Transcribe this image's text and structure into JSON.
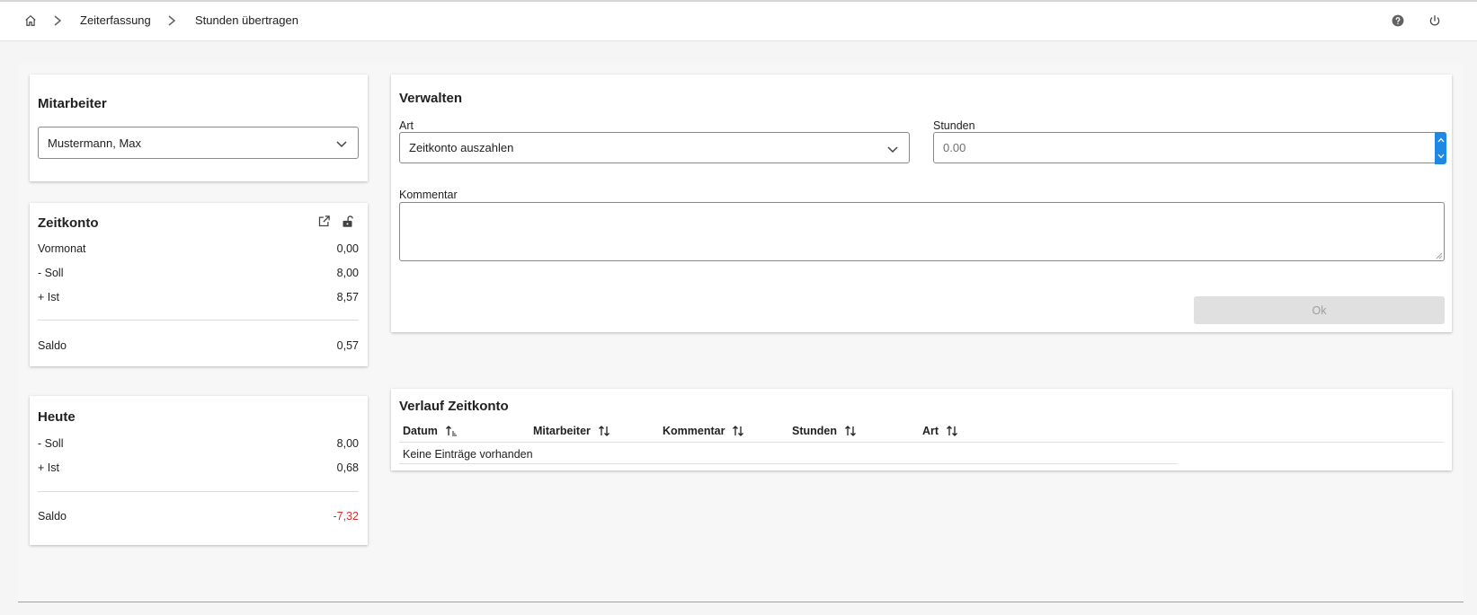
{
  "breadcrumb": {
    "home_icon": "home-icon",
    "items": [
      "Zeiterfassung",
      "Stunden übertragen"
    ]
  },
  "header_icons": [
    "help-icon",
    "power-icon"
  ],
  "mitarbeiter": {
    "title": "Mitarbeiter",
    "selected": "Mustermann, Max"
  },
  "zeitkonto": {
    "title": "Zeitkonto",
    "rows": [
      {
        "label": "Vormonat",
        "value": "0,00"
      },
      {
        "label": "- Soll",
        "value": "8,00"
      },
      {
        "label": "+ Ist",
        "value": "8,57"
      }
    ],
    "saldo": {
      "label": "Saldo",
      "value": "0,57"
    }
  },
  "heute": {
    "title": "Heute",
    "rows": [
      {
        "label": "- Soll",
        "value": "8,00"
      },
      {
        "label": "+ Ist",
        "value": "0,68"
      }
    ],
    "saldo": {
      "label": "Saldo",
      "value": "-7,32",
      "color": "#d32f2f"
    }
  },
  "verwalten": {
    "title": "Verwalten",
    "art_label": "Art",
    "art_value": "Zeitkonto auszahlen",
    "stunden_label": "Stunden",
    "stunden_value": "0.00",
    "kommentar_label": "Kommentar",
    "kommentar_value": "",
    "ok_label": "Ok"
  },
  "verlauf": {
    "title": "Verlauf Zeitkonto",
    "columns": [
      "Datum",
      "Mitarbeiter",
      "Kommentar",
      "Stunden",
      "Art"
    ],
    "empty_text": "Keine Einträge vorhanden"
  },
  "colors": {
    "accent": "#1e88e5",
    "negative": "#d32f2f",
    "disabled_button": "#e0e0e0"
  }
}
